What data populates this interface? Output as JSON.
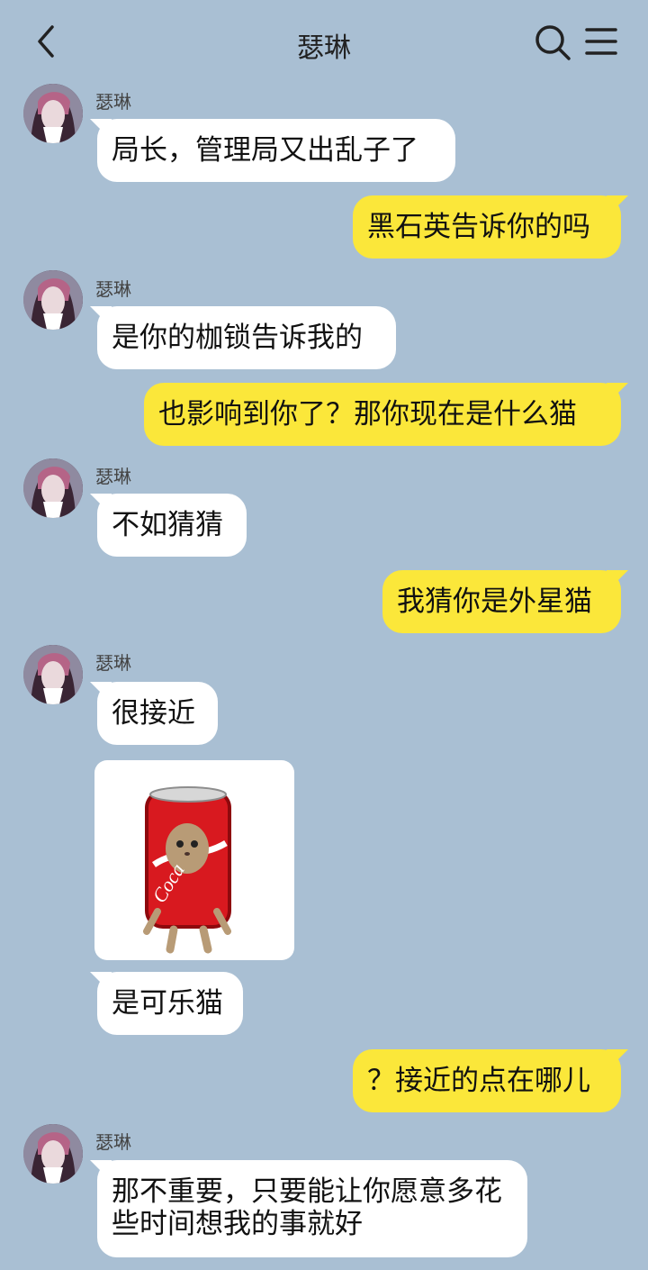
{
  "header": {
    "title": "瑟琳"
  },
  "messages": [
    {
      "side": "in",
      "sender": "瑟琳",
      "text": "局长，管理局又出乱子了"
    },
    {
      "side": "out",
      "text": "黑石英告诉你的吗"
    },
    {
      "side": "in",
      "sender": "瑟琳",
      "text": "是你的枷锁告诉我的"
    },
    {
      "side": "out",
      "text": "也影响到你了？那你现在是什么猫"
    },
    {
      "side": "in",
      "sender": "瑟琳",
      "text": "不如猜猜"
    },
    {
      "side": "out",
      "text": "我猜你是外星猫"
    },
    {
      "side": "in",
      "sender": "瑟琳",
      "text": "很接近"
    },
    {
      "side": "in",
      "type": "sticker",
      "sticker_text": "Coca"
    },
    {
      "side": "in",
      "text": "是可乐猫"
    },
    {
      "side": "out",
      "text": "？接近的点在哪儿"
    },
    {
      "side": "in",
      "sender": "瑟琳",
      "text": "那不重要，只要能让你愿意多花些时间想我的事就好"
    }
  ],
  "icons": {
    "back": "chevron-left-icon",
    "search": "search-icon",
    "menu": "menu-icon",
    "avatar": "character-avatar-icon"
  },
  "colors": {
    "background": "#a9bfd3",
    "incoming_bubble": "#ffffff",
    "outgoing_bubble": "#fbe73a"
  }
}
